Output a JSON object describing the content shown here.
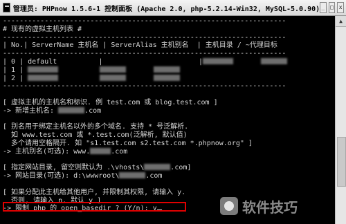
{
  "window": {
    "title": "管理员:  PHPnow 1.5.6-1 控制面板 (Apache 2.0, php-5.2.14-Win32, MySQL-5.0.90)",
    "minimize_glyph": "_",
    "maximize_glyph": "□",
    "close_glyph": "x"
  },
  "console": {
    "lines": [
      "--------------------------------------------------------------------",
      "# 现有的虚拟主机列表 #",
      "--------------------------------------------------------------------",
      "| No.| ServerName 主机名 | ServerAlias 主机别名  | 主机目录 / ~代理目标",
      "--------------------------------------------------------------------",
      "| 0 | default          |                       |",
      "| 1 |",
      "| 2 |",
      "--------------------------------------------------------------------",
      "",
      "[ 虚拟主机的主机名和标识. 例 test.com 或 blog.test.com ]",
      "-> 新增主机名:",
      "",
      "[ 别名用于绑定主机名以外的多个域名. 支持 * 号泛解析.",
      "  如 www.test.com 或 *.test.com(泛解析, 默认值)",
      "  多个请用空格隔开. 如 \"s1.test.com s2.test.com *.phpnow.org\" ]",
      "-> 主机别名(可选): www.",
      "",
      "[ 指定网站目录, 留空则默认为 .\\vhosts\\",
      "-> 网站目录(可选): d:\\wwwroot\\",
      "",
      "[ 如果分配此主机给其他用户, 并限制其权限, 请输入 y.",
      "  否则, 请输入 n. 默认 y ]",
      "-> 限制 php 的 open_basedir ? (Y/n): y"
    ],
    "suffix_com": ".com",
    "suffix_com_bracket": ".com]"
  },
  "watermark": {
    "text": "软件技巧"
  },
  "scrollbar": {
    "up_glyph": "▲"
  }
}
